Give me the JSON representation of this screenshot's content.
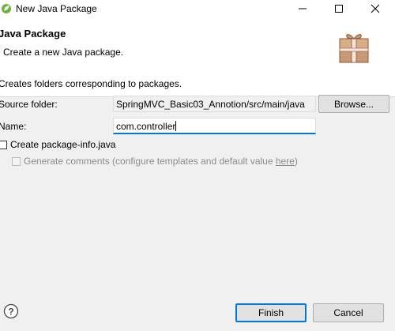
{
  "window": {
    "title": "New Java Package"
  },
  "banner": {
    "title": "Java Package",
    "subtitle": "Create a new Java package."
  },
  "form": {
    "description": "Creates folders corresponding to packages.",
    "source_folder_label": "Source folder:",
    "source_folder_value": "SpringMVC_Basic03_Annotion/src/main/java",
    "browse_label": "Browse...",
    "name_label": "Name:",
    "name_value": "com.controller",
    "create_package_info_label": "Create package-info.java",
    "create_package_info_checked": false,
    "generate_comments_prefix": "Generate comments (configure templates and default value ",
    "generate_comments_link": "here",
    "generate_comments_suffix": ")",
    "generate_comments_checked": false
  },
  "footer": {
    "finish_label": "Finish",
    "cancel_label": "Cancel"
  },
  "icons": {
    "app": "eclipse-spring-icon",
    "wizard": "package-icon",
    "help": "help-icon"
  },
  "colors": {
    "focus_border": "#0078d7",
    "dialog_bg": "#f0f0f0",
    "banner_bg": "#ffffff"
  }
}
